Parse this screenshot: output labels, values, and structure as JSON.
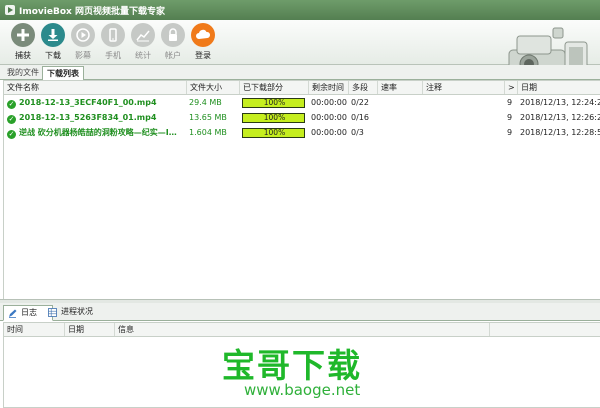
{
  "window": {
    "title": "ImovieBox 网页视频批量下载专家"
  },
  "toolbar": {
    "buttons": [
      {
        "label": "捕获",
        "icon": "plus-icon",
        "color": "#7a8b7a",
        "enabled": true
      },
      {
        "label": "下载",
        "icon": "download-icon",
        "color": "#2c8a8c",
        "enabled": true
      },
      {
        "label": "影幕",
        "icon": "play-icon",
        "enabled": false
      },
      {
        "label": "手机",
        "icon": "phone-icon",
        "enabled": false
      },
      {
        "label": "统计",
        "icon": "chart-icon",
        "enabled": false
      },
      {
        "label": "帐户",
        "icon": "lock-icon",
        "enabled": false
      },
      {
        "label": "登录",
        "icon": "cloud-icon",
        "color": "#f07a1a",
        "enabled": true
      }
    ]
  },
  "tabs": {
    "mine": "我的文件",
    "downloads": "下载列表"
  },
  "table": {
    "columns": {
      "name": "文件名称",
      "size": "文件大小",
      "progress": "已下载部分",
      "remaining": "剩余时间",
      "segments": "多段",
      "speed": "速率",
      "note": "注释",
      "more": ">",
      "date": "日期"
    },
    "rows": [
      {
        "name": "2018-12-13_3ECF40F1_00.mp4",
        "size": "29.4 MB",
        "progress": 1.0,
        "progress_text": "100%",
        "remaining": "00:00:00",
        "segments": "0/22",
        "speed": "",
        "note": "",
        "more": "9",
        "date": "2018/12/13, 12:24:2"
      },
      {
        "name": "2018-12-13_5263F834_01.mp4",
        "size": "13.65 MB",
        "progress": 1.0,
        "progress_text": "100%",
        "remaining": "00:00:00",
        "segments": "0/16",
        "speed": "",
        "note": "",
        "more": "9",
        "date": "2018/12/13, 12:26:2"
      },
      {
        "name": "逆战 砍分机器杨皓喆的洞粉攻略—纪实—I…",
        "size": "1.604 MB",
        "progress": 1.0,
        "progress_text": "100%",
        "remaining": "00:00:00",
        "segments": "0/3",
        "speed": "",
        "note": "",
        "more": "9",
        "date": "2018/12/13, 12:28:5"
      }
    ]
  },
  "bottom_tabs": {
    "log": "日志",
    "process": "进程状况"
  },
  "log": {
    "columns": {
      "time": "时间",
      "date": "日期",
      "info": "信息"
    }
  },
  "watermark": {
    "title": "宝哥下载",
    "url": "www.baoge.net"
  },
  "colors": {
    "accent_green": "#1fb82a",
    "progress_fill": "#c5ee1e",
    "file_name": "#1f8f1f"
  }
}
